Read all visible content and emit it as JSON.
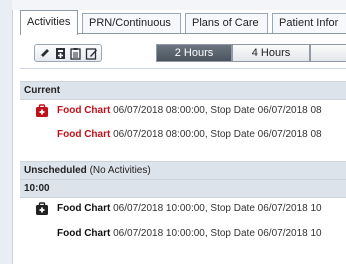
{
  "tabs": [
    {
      "label": "Activities",
      "active": true
    },
    {
      "label": "PRN/Continuous",
      "active": false
    },
    {
      "label": "Plans of Care",
      "active": false
    },
    {
      "label": "Patient Infor",
      "active": false
    }
  ],
  "toolbar": {
    "icons": [
      "pencil-icon",
      "add-document-icon",
      "clipboard-icon",
      "edit-document-icon"
    ],
    "time_buttons": [
      {
        "label": "2 Hours",
        "selected": true
      },
      {
        "label": "4 Hours",
        "selected": false
      }
    ]
  },
  "sections": {
    "current": {
      "title": "Current"
    },
    "unscheduled": {
      "title": "Unscheduled",
      "note": "(No Activities)"
    },
    "time_10": {
      "title": "10:00"
    }
  },
  "rows": [
    {
      "name": "Food Chart",
      "detail": "06/07/2018 08:00:00, Stop Date 06/07/2018 08",
      "icon": "alert-case-icon",
      "icon_color": "#c0111a",
      "name_color": "#c0111a"
    },
    {
      "name": "Food Chart",
      "detail": "06/07/2018 08:00:00, Stop Date 06/07/2018 08",
      "icon": "",
      "icon_color": "",
      "name_color": "#c0111a"
    },
    {
      "name": "Food Chart",
      "detail": "06/07/2018 10:00:00, Stop Date 06/07/2018 10",
      "icon": "case-icon",
      "icon_color": "#222222",
      "name_color": "#111111"
    },
    {
      "name": "Food Chart",
      "detail": "06/07/2018 10:00:00, Stop Date 06/07/2018 10",
      "icon": "",
      "icon_color": "",
      "name_color": "#111111"
    }
  ]
}
